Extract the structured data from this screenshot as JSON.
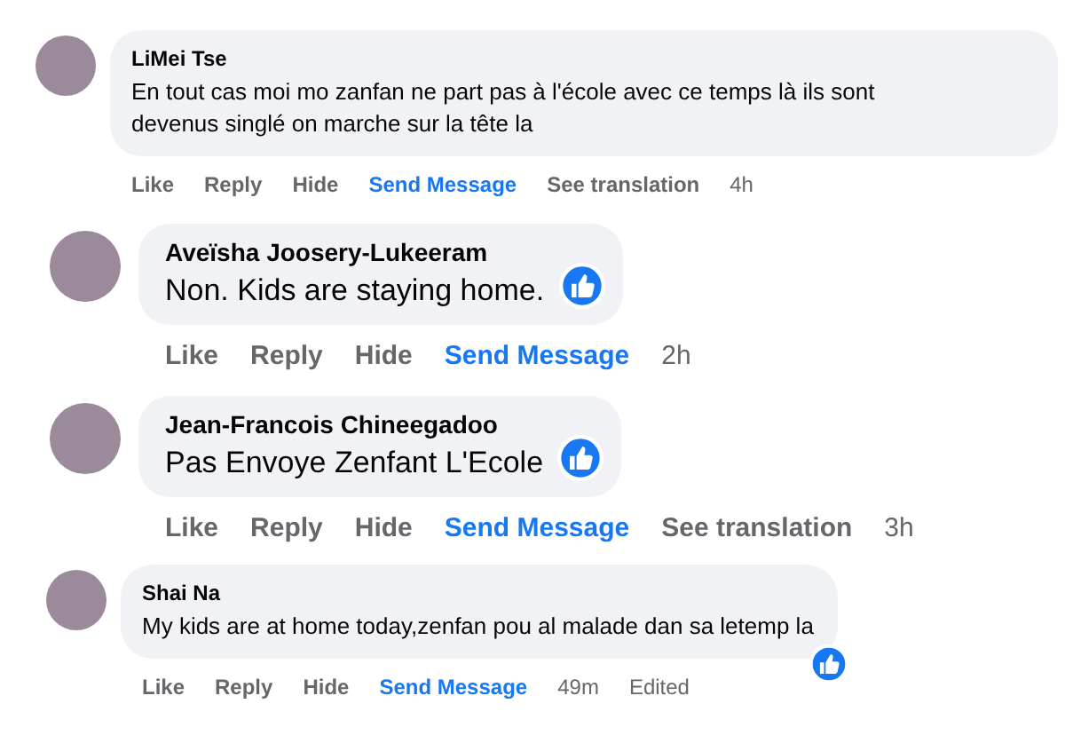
{
  "comments": [
    {
      "kind": "small",
      "author": "LiMei Tse",
      "text": "En tout cas moi mo zanfan ne part pas à l'école avec ce temps là ils sont devenus singlé on marche sur la tête la",
      "reaction": false,
      "actions": [
        {
          "kind": "link",
          "label": "Like"
        },
        {
          "kind": "link",
          "label": "Reply"
        },
        {
          "kind": "link",
          "label": "Hide"
        },
        {
          "kind": "send",
          "label": "Send Message"
        },
        {
          "kind": "link",
          "label": "See translation"
        },
        {
          "kind": "meta",
          "label": "4h"
        }
      ]
    },
    {
      "kind": "large",
      "author": "Aveïsha Joosery-Lukeeram",
      "text": "Non. Kids are staying home.",
      "reaction": true,
      "actions": [
        {
          "kind": "link",
          "label": "Like"
        },
        {
          "kind": "link",
          "label": "Reply"
        },
        {
          "kind": "link",
          "label": "Hide"
        },
        {
          "kind": "send",
          "label": "Send Message"
        },
        {
          "kind": "meta",
          "label": "2h"
        }
      ]
    },
    {
      "kind": "large",
      "author": "Jean-Francois Chineegadoo",
      "text": "Pas Envoye Zenfant L'Ecole",
      "reaction": true,
      "actions": [
        {
          "kind": "link",
          "label": "Like"
        },
        {
          "kind": "link",
          "label": "Reply"
        },
        {
          "kind": "link",
          "label": "Hide"
        },
        {
          "kind": "send",
          "label": "Send Message"
        },
        {
          "kind": "link",
          "label": "See translation"
        },
        {
          "kind": "meta",
          "label": "3h"
        }
      ]
    },
    {
      "kind": "small",
      "author": "Shai Na",
      "text": "My kids are at home today,zenfan pou al malade dan sa letemp la",
      "reaction": true,
      "actions": [
        {
          "kind": "link",
          "label": "Like"
        },
        {
          "kind": "link",
          "label": "Reply"
        },
        {
          "kind": "link",
          "label": "Hide"
        },
        {
          "kind": "send",
          "label": "Send Message"
        },
        {
          "kind": "meta",
          "label": "49m"
        },
        {
          "kind": "meta",
          "label": "Edited"
        }
      ]
    }
  ]
}
